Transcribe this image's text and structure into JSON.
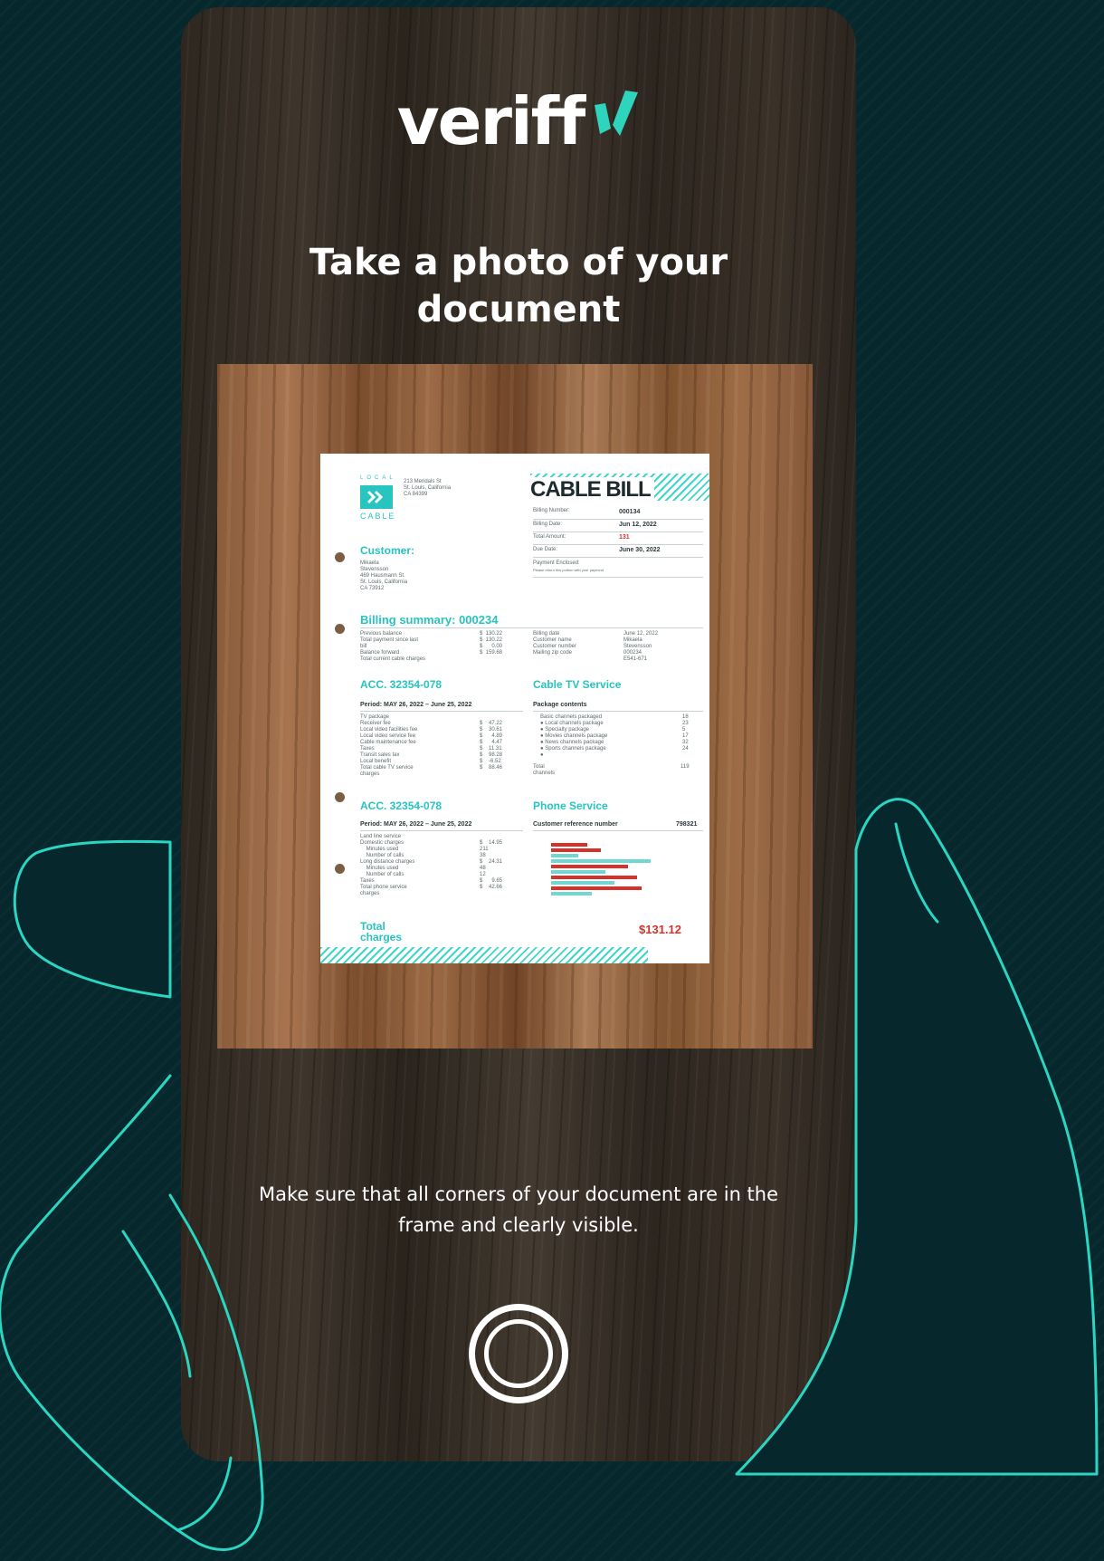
{
  "app": {
    "logo_text": "veriff",
    "title": "Take a photo of your document",
    "hint": "Make sure that all corners of your document are in the frame and clearly visible."
  },
  "colors": {
    "accent": "#27c4c0",
    "background": "#06282c",
    "hand_outline": "#2ad6c2",
    "doc_red": "#d6322a"
  },
  "icons": {
    "logo_mark": "veriff-check-icon",
    "shutter": "shutter-button-icon",
    "doc_logo": "double-chevron-icon"
  },
  "document": {
    "brand_top": "LOCAL",
    "brand_bottom": "CABLE",
    "address": "213 Meridals St\nSt. Louis, California\nCA 84399",
    "title": "CABLE BILL",
    "bill_info": [
      {
        "label": "Billing Number:",
        "value": "000134"
      },
      {
        "label": "Billing Date:",
        "value": "Jun 12, 2022"
      },
      {
        "label": "Total Amount:",
        "value": "131"
      },
      {
        "label": "Due Date:",
        "value": "June 30, 2022"
      }
    ],
    "payment_label": "Payment Enclosed:",
    "payment_note": "Please return this portion with your payment",
    "customer_heading": "Customer:",
    "customer_address": "Mikaela\nStevensson\n469 Hausmann St.\nSt. Louis, California\nCA 73912",
    "billing_summary_heading": "Billing summary: 000234",
    "summary_labels": "Previous balance\nTotal payment since last\nbill\nBalance forward\nTotal current cable charges",
    "summary_values": "$  130.22\n$  130.22\n$      0.00\n$  159.68",
    "summary_right_labels": "Billing date\nCustomer name\nCustomer number\nMailing zip code",
    "summary_right_values": "June 12, 2022\nMikaela\nStevensson\n000234\nE541-671",
    "acc1_heading": "ACC. 32354-078",
    "tv_heading": "Cable TV Service",
    "period1": "Period: MAY 26, 2022 – June 25, 2022",
    "tv_labels": "TV package\nReceiver fee\nLocal video facilities fee\nLocal video service fee\nCable maintenance fee\nTaxes\nTransit sales tax\nLocal benefit\nTotal cable TV service\ncharges",
    "tv_values": "$    47.22\n$    30.61\n$      4.89\n$      4.47\n$    11.31\n$    98.28\n$    -6.52\n$    88.46",
    "package_heading": "Package contents",
    "package_labels": "Basic channels packaged\n● Local channels package\n● Specialty package\n● Movies channels package\n● News channels package\n● Sports channels package\n●",
    "package_values": "18\n23\n5\n17\n32\n24",
    "total_channels_label": "Total\nchannels",
    "total_channels_value": "119",
    "acc2_heading": "ACC. 32354-078",
    "phone_heading": "Phone Service",
    "period2": "Period: MAY 26, 2022 – June 25, 2022",
    "ref_label": "Customer reference number",
    "ref_value": "798321",
    "phone_labels": "Land line service\nDomestic charges\n    Minutes used\n    Number of calls\nLong distance charges\n    Minutes used\n    Number of calls\nTaxes\nTotal phone service\ncharges",
    "phone_values": "$    14.95\n211\n38\n$    24.31\n48\n12\n$      9.65\n$    42.66",
    "total_label": "Total\ncharges",
    "total_value": "$131.12"
  }
}
